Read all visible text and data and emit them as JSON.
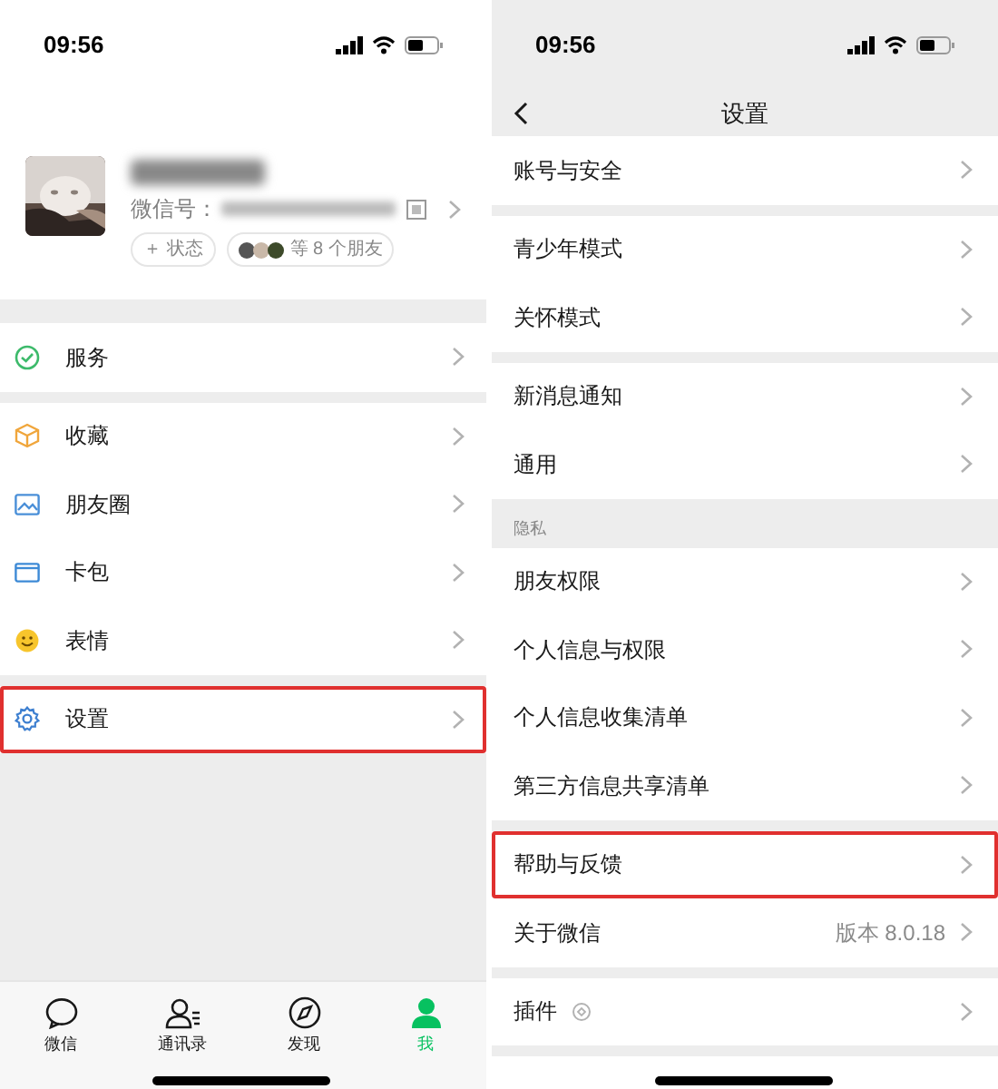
{
  "left": {
    "status_bar": {
      "time": "09:56"
    },
    "profile": {
      "wechat_id_label": "微信号：",
      "status_button": "＋ 状态",
      "friends_text": "等 8 个朋友"
    },
    "menu_groups": [
      [
        {
          "label": "服务",
          "highlighted": false
        }
      ],
      [
        {
          "label": "收藏",
          "highlighted": false
        },
        {
          "label": "朋友圈",
          "highlighted": false
        },
        {
          "label": "卡包",
          "highlighted": false
        },
        {
          "label": "表情",
          "highlighted": false
        }
      ],
      [
        {
          "label": "设置",
          "highlighted": true
        }
      ]
    ],
    "tabs": [
      {
        "label": "微信",
        "selected": false
      },
      {
        "label": "通讯录",
        "selected": false
      },
      {
        "label": "发现",
        "selected": false
      },
      {
        "label": "我",
        "selected": true
      }
    ]
  },
  "right": {
    "status_bar": {
      "time": "09:56"
    },
    "title": "设置",
    "groups": [
      {
        "items": [
          {
            "label": "账号与安全",
            "highlighted": false
          }
        ]
      },
      {
        "items": [
          {
            "label": "青少年模式",
            "highlighted": false
          },
          {
            "label": "关怀模式",
            "highlighted": false
          }
        ]
      },
      {
        "items": [
          {
            "label": "新消息通知",
            "highlighted": false
          },
          {
            "label": "通用",
            "highlighted": false
          }
        ]
      },
      {
        "header": "隐私",
        "items": [
          {
            "label": "朋友权限",
            "highlighted": false
          },
          {
            "label": "个人信息与权限",
            "highlighted": false
          },
          {
            "label": "个人信息收集清单",
            "highlighted": false
          },
          {
            "label": "第三方信息共享清单",
            "highlighted": false
          }
        ]
      },
      {
        "items": [
          {
            "label": "帮助与反馈",
            "highlighted": true
          },
          {
            "label": "关于微信",
            "value": "版本 8.0.18",
            "highlighted": false
          }
        ]
      },
      {
        "items": [
          {
            "label": "插件",
            "kind": "with-icon",
            "highlighted": false
          }
        ]
      }
    ]
  }
}
